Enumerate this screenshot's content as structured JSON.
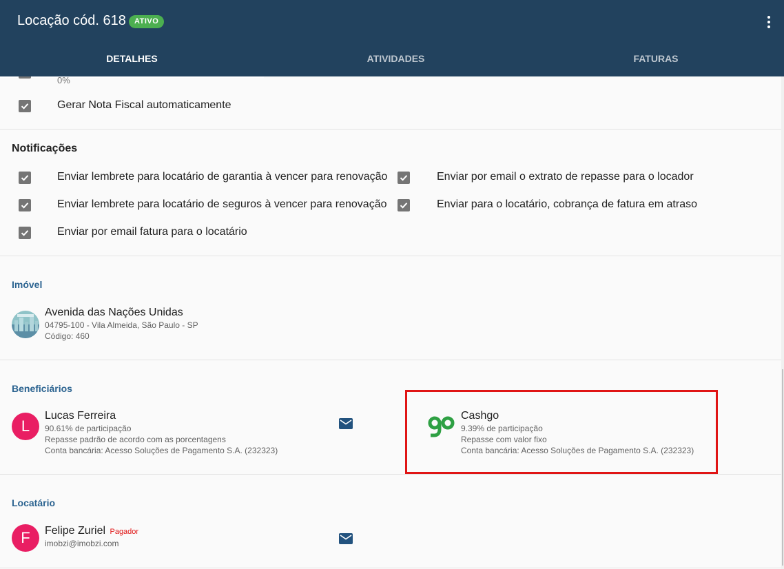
{
  "header": {
    "title": "Locação cód. 618",
    "status_badge": "ATIVO",
    "tabs": [
      "DETALHES",
      "ATIVIDADES",
      "FATURAS"
    ]
  },
  "partial_row": {
    "value": "0%"
  },
  "options": {
    "nota_fiscal_label": "Gerar Nota Fiscal automaticamente"
  },
  "notificacoes": {
    "title": "Notificações",
    "items": [
      "Enviar lembrete para locatário de garantia à vencer para renovação",
      "Enviar por email o extrato de repasse para o locador",
      "Enviar lembrete para locatário de seguros à vencer para renovação",
      "Enviar para o locatário, cobrança de fatura em atraso",
      "Enviar por email fatura para o locatário"
    ]
  },
  "imovel": {
    "title": "Imóvel",
    "address": "Avenida das Nações Unidas",
    "location": "04795-100 - Vila Almeida, São Paulo - SP",
    "code": "Código: 460"
  },
  "beneficiarios": {
    "title": "Beneficiários",
    "items": [
      {
        "initial": "L",
        "name": "Lucas Ferreira",
        "share": "90.61% de participação",
        "repasse": "Repasse padrão de acordo com as porcentagens",
        "bank": "Conta bancária: Acesso Soluções de Pagamento S.A. (232323)"
      },
      {
        "name": "Cashgo",
        "share": "9.39% de participação",
        "repasse": "Repasse com valor fixo",
        "bank": "Conta bancária: Acesso Soluções de Pagamento S.A. (232323)"
      }
    ]
  },
  "locatario": {
    "title": "Locatário",
    "initial": "F",
    "name": "Felipe Zuriel",
    "tag": "Pagador",
    "email": "imobzi@imobzi.com"
  },
  "colors": {
    "appbar": "#22425e",
    "badge": "#4caf50",
    "section_title": "#2b6390",
    "avatar": "#e91e63",
    "cashgo": "#2ea043",
    "highlight": "#e01515"
  },
  "icons": [
    "more-vert-icon",
    "checkbox-checked-icon",
    "mail-icon",
    "cashgo-logo"
  ]
}
